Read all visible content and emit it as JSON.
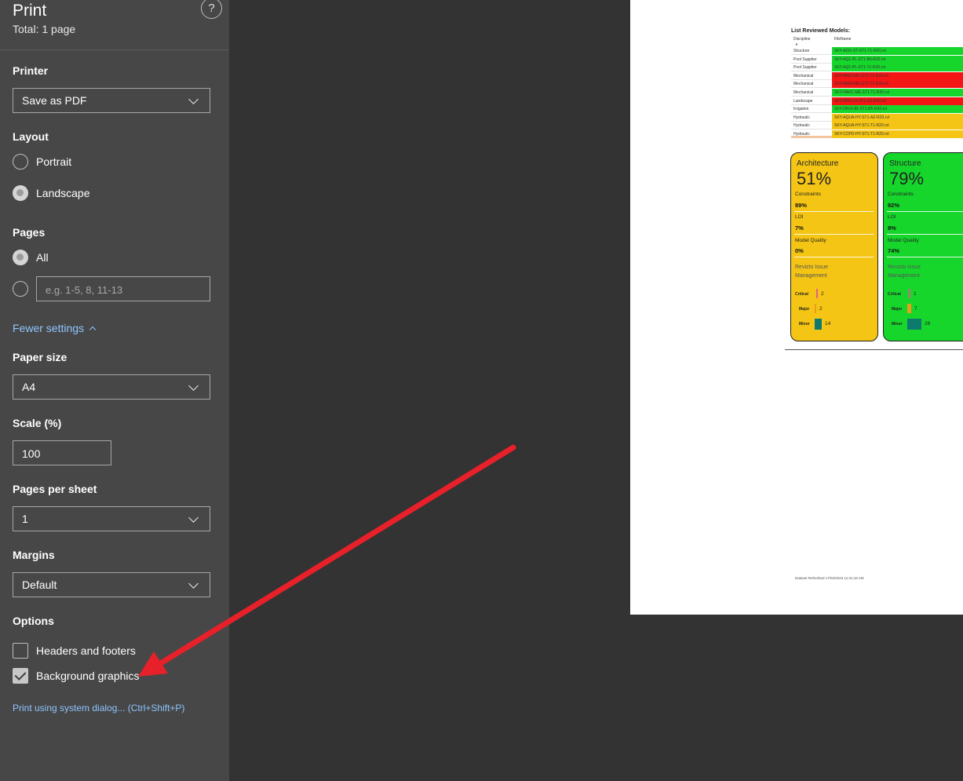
{
  "print": {
    "title": "Print",
    "total": "Total: 1 page",
    "help": "?"
  },
  "printer": {
    "label": "Printer",
    "value": "Save as PDF"
  },
  "layout": {
    "label": "Layout",
    "portrait": "Portrait",
    "landscape": "Landscape",
    "selected": "Landscape"
  },
  "pages": {
    "label": "Pages",
    "all": "All",
    "custom_placeholder": "e.g. 1-5, 8, 11-13"
  },
  "fewer_settings": "Fewer settings",
  "paper_size": {
    "label": "Paper size",
    "value": "A4"
  },
  "scale": {
    "label": "Scale (%)",
    "value": "100"
  },
  "pages_per_sheet": {
    "label": "Pages per sheet",
    "value": "1"
  },
  "margins": {
    "label": "Margins",
    "value": "Default"
  },
  "options": {
    "label": "Options",
    "headers_footers": "Headers and footers",
    "headers_footers_checked": false,
    "background_graphics": "Background graphics",
    "background_graphics_checked": true
  },
  "system_dialog": "Print using system dialog... (Ctrl+Shift+P)",
  "preview": {
    "list_title": "List Reviewed Models:",
    "col_discipline": "Discipline",
    "col_filename": "FileName",
    "colors": {
      "green": "#16d62c",
      "red": "#f41515",
      "yellow": "#f4c514",
      "teal": "#0e7a6e",
      "orange": "#f09a16",
      "pink": "#e0608a"
    },
    "rows": [
      {
        "discipline": "Structure",
        "file": "SKY-ADG-ST-ST1-T1-R20.rvt",
        "status": "green"
      },
      {
        "discipline": "Pool Supplier",
        "file": "SKY-AQ1-PL-ST1-B5-R20.rvt",
        "status": "green"
      },
      {
        "discipline": "Pool Supplier",
        "file": "SKY-AQ1-PL-ST1-T1-R20.rvt",
        "status": "green"
      },
      {
        "discipline": "Mechanical",
        "file": "SKY-BRIG-ME-ST1-T1-R20.rvt",
        "status": "red"
      },
      {
        "discipline": "Mechanical",
        "file": "SKY-BRIG-ME-ST1-T1-R20.rvt",
        "status": "red"
      },
      {
        "discipline": "Mechanical",
        "file": "SKY-NAVC-ME-ST1-T1-R20.rvt",
        "status": "green"
      },
      {
        "discipline": "Landscape",
        "file": "SKY-RPS-LA-ST1-ZX-R20.rvt",
        "status": "red"
      },
      {
        "discipline": "Irrigation",
        "file": "SKY-DPoV-IR-ST1-B5-R20.rvt",
        "status": "green"
      },
      {
        "discipline": "Hydraulic",
        "file": "SKY-AQUA-HY-ST1-AZ-R20.rvt",
        "status": "yellow"
      },
      {
        "discipline": "Hydraulic",
        "file": "SKY-AQUA-HY-ST1-T1-R20.rvt",
        "status": "yellow"
      },
      {
        "discipline": "Hydraulic",
        "file": "SKY-CCPD-HY-ST1-T1-R20.rvt",
        "status": "yellow"
      }
    ],
    "cards": [
      {
        "name": "Architecture",
        "pct": "51%",
        "color": "#f4c514",
        "constraints_label": "Constraints",
        "constraints": "89%",
        "loi_label": "LOI",
        "loi": "7%",
        "quality_label": "Model Quality",
        "quality": "0%",
        "issue_label": "Revizto Issue Management",
        "critical_label": "Critical",
        "critical": 2,
        "major_label": "Major",
        "major": 2,
        "minor_label": "Minor",
        "minor": 14
      },
      {
        "name": "Structure",
        "pct": "79%",
        "color": "#16d62c",
        "constraints_label": "Constraints",
        "constraints": "92%",
        "loi_label": "LOI",
        "loi": "8%",
        "quality_label": "Model Quality",
        "quality": "74%",
        "issue_label": "Revizto Issue Management",
        "critical_label": "Critical",
        "critical": 1,
        "major_label": "Major",
        "major": 7,
        "minor_label": "Minor",
        "minor": 28
      }
    ],
    "footer": "Dataset Refreshed  17/02/2023 11:31:18 AM"
  },
  "annotation": {
    "arrow_color": "#e8202a"
  }
}
